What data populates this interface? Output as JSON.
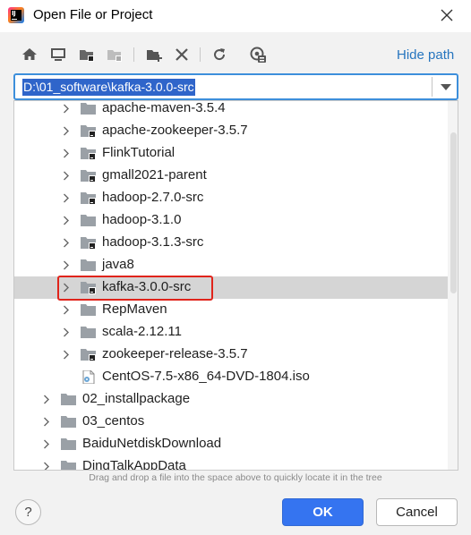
{
  "dialog": {
    "title": "Open File or Project"
  },
  "toolbar": {
    "hide_path_label": "Hide path",
    "icons": [
      "home-icon",
      "desktop-icon",
      "project-folder-icon",
      "module-folder-icon",
      "new-folder-icon",
      "delete-icon",
      "refresh-icon",
      "show-hidden-icon"
    ]
  },
  "path": {
    "value": "D:\\01_software\\kafka-3.0.0-src"
  },
  "tree": {
    "rows": [
      {
        "label": "apache-maven-3.5.4",
        "type": "folder",
        "level": 1,
        "expandable": true
      },
      {
        "label": "apache-zookeeper-3.5.7",
        "type": "project-folder",
        "level": 1,
        "expandable": true
      },
      {
        "label": "FlinkTutorial",
        "type": "project-folder",
        "level": 1,
        "expandable": true
      },
      {
        "label": "gmall2021-parent",
        "type": "project-folder",
        "level": 1,
        "expandable": true
      },
      {
        "label": "hadoop-2.7.0-src",
        "type": "project-folder",
        "level": 1,
        "expandable": true
      },
      {
        "label": "hadoop-3.1.0",
        "type": "folder",
        "level": 1,
        "expandable": true
      },
      {
        "label": "hadoop-3.1.3-src",
        "type": "project-folder",
        "level": 1,
        "expandable": true
      },
      {
        "label": "java8",
        "type": "folder",
        "level": 1,
        "expandable": true
      },
      {
        "label": "kafka-3.0.0-src",
        "type": "project-folder",
        "level": 1,
        "expandable": true,
        "selected": true
      },
      {
        "label": "RepMaven",
        "type": "folder",
        "level": 1,
        "expandable": true
      },
      {
        "label": "scala-2.12.11",
        "type": "folder",
        "level": 1,
        "expandable": true
      },
      {
        "label": "zookeeper-release-3.5.7",
        "type": "project-folder",
        "level": 1,
        "expandable": true
      },
      {
        "label": "CentOS-7.5-x86_64-DVD-1804.iso",
        "type": "file",
        "level": 1,
        "expandable": false
      },
      {
        "label": "02_installpackage",
        "type": "folder",
        "level": 0,
        "expandable": true
      },
      {
        "label": "03_centos",
        "type": "folder",
        "level": 0,
        "expandable": true
      },
      {
        "label": "BaiduNetdiskDownload",
        "type": "folder",
        "level": 0,
        "expandable": true
      },
      {
        "label": "DingTalkAppData",
        "type": "folder",
        "level": 0,
        "expandable": true
      }
    ]
  },
  "hint": {
    "text": "Drag and drop a file into the space above to quickly locate it in the tree"
  },
  "buttons": {
    "help": "?",
    "ok": "OK",
    "cancel": "Cancel"
  },
  "colors": {
    "accent": "#3574f0",
    "link": "#2675bf",
    "highlight_box": "#e0241b",
    "path_selection": "#2f65ca"
  }
}
